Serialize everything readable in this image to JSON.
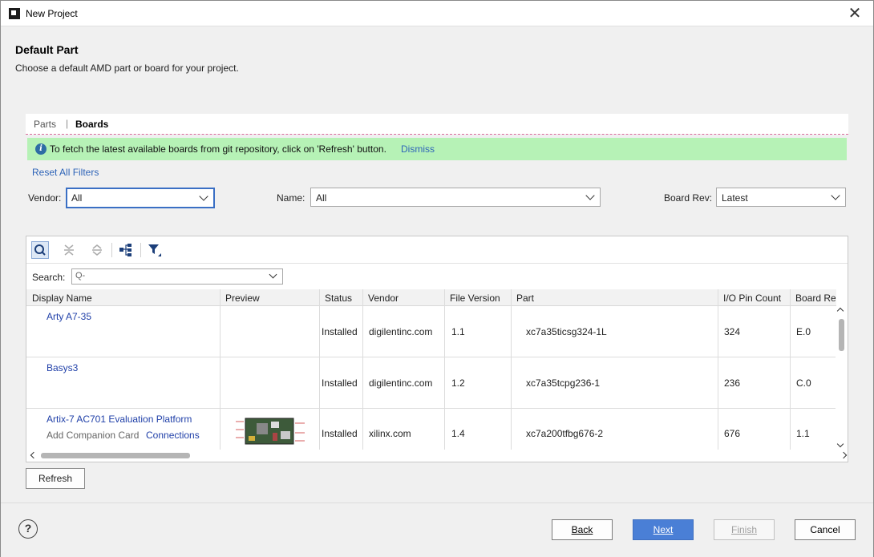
{
  "window": {
    "title": "New Project"
  },
  "header": {
    "heading": "Default Part",
    "description": "Choose a default AMD part or board for your project."
  },
  "tabs": {
    "parts": "Parts",
    "separator": "|",
    "boards": "Boards"
  },
  "info_bar": {
    "message": "To fetch the latest available boards from git repository, click on 'Refresh' button.",
    "dismiss": "Dismiss"
  },
  "filters": {
    "reset": "Reset All Filters",
    "vendor": {
      "label": "Vendor:",
      "value": "All"
    },
    "name": {
      "label": "Name:",
      "value": "All"
    },
    "board_rev": {
      "label": "Board Rev:",
      "value": "Latest"
    }
  },
  "search": {
    "label": "Search:",
    "placeholder": "Q-"
  },
  "columns": [
    "Display Name",
    "Preview",
    "Status",
    "Vendor",
    "File Version",
    "Part",
    "I/O Pin Count",
    "Board Re"
  ],
  "rows": [
    {
      "display_name": "Arty A7-35",
      "status": "Installed",
      "vendor": "digilentinc.com",
      "file_version": "1.1",
      "part": "xc7a35ticsg324-1L",
      "io_pin_count": "324",
      "board_rev": "E.0"
    },
    {
      "display_name": "Basys3",
      "status": "Installed",
      "vendor": "digilentinc.com",
      "file_version": "1.2",
      "part": "xc7a35tcpg236-1",
      "io_pin_count": "236",
      "board_rev": "C.0"
    },
    {
      "display_name": "Artix-7 AC701 Evaluation Platform",
      "companion_label": "Add Companion Card",
      "companion_link": "Connections",
      "status": "Installed",
      "vendor": "xilinx.com",
      "file_version": "1.4",
      "part": "xc7a200tfbg676-2",
      "io_pin_count": "676",
      "board_rev": "1.1"
    }
  ],
  "buttons": {
    "refresh": "Refresh",
    "help": "?",
    "back": "Back",
    "next": "Next",
    "finish": "Finish",
    "cancel": "Cancel"
  },
  "colors": {
    "accent": "#4a7fd6",
    "info_bg": "#b6f2b6",
    "link": "#2e64b8"
  }
}
